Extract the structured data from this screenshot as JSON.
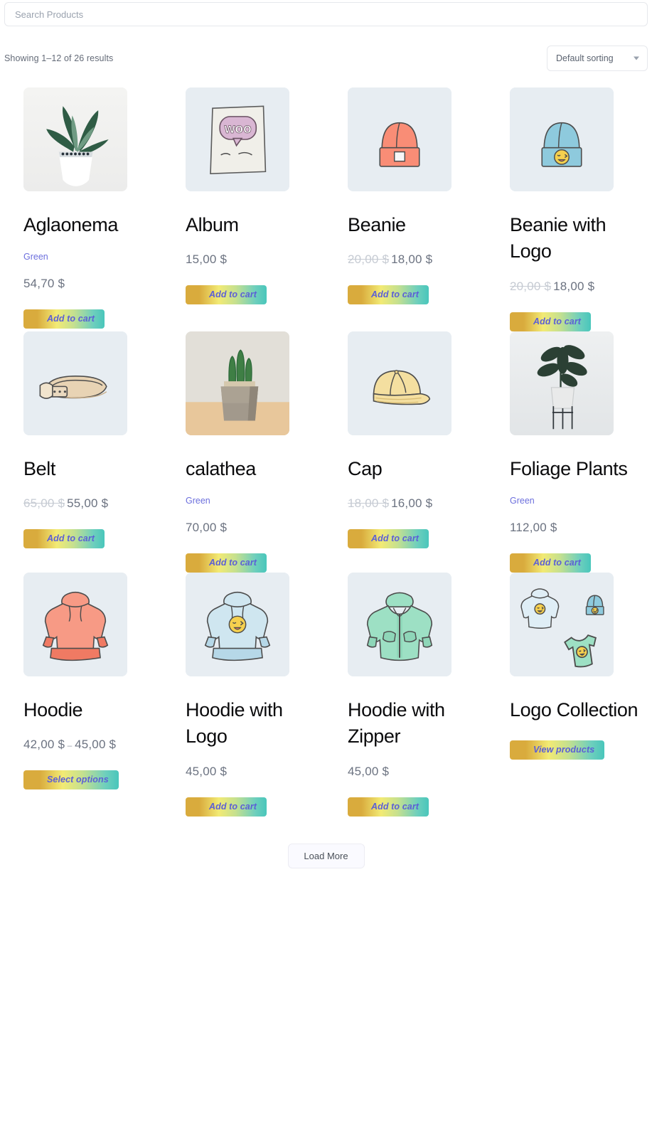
{
  "search": {
    "placeholder": "Search Products",
    "value": ""
  },
  "results": {
    "count_text": "Showing 1–12 of 26 results",
    "sorting_label": "Default sorting"
  },
  "colors": {
    "link": "#6c6fdd",
    "price": "#6b7280",
    "price_old": "#c6cbd3",
    "button_text": "#5b5fd6",
    "button_gradient_start": "#d9ab3d",
    "button_gradient_mid": "#f2ea74",
    "button_gradient_end": "#49c6bb",
    "thumb_bg": "#e7edf2"
  },
  "products": [
    {
      "name": "Aglaonema",
      "attribute": "Green",
      "price": "54,70 $",
      "old_price": "",
      "price_range_end": "",
      "button": "Add to cart",
      "image_kind": "photo-aglaonema",
      "image_alt": "potted aglaonema plant in white pot"
    },
    {
      "name": "Album",
      "attribute": "",
      "price": "15,00 $",
      "old_price": "",
      "price_range_end": "",
      "button": "Add to cart",
      "image_kind": "illus-album",
      "image_alt": "Woo the album sketch cover"
    },
    {
      "name": "Beanie",
      "attribute": "",
      "price": "18,00 $",
      "old_price": "20,00 $",
      "price_range_end": "",
      "button": "Add to cart",
      "image_kind": "illus-beanie",
      "image_alt": "salmon coloured beanie hat"
    },
    {
      "name": "Beanie with Logo",
      "attribute": "",
      "price": "18,00 $",
      "old_price": "20,00 $",
      "price_range_end": "",
      "button": "Add to cart",
      "image_kind": "illus-beanie-logo",
      "image_alt": "blue beanie hat with winking face logo"
    },
    {
      "name": "Belt",
      "attribute": "",
      "price": "55,00 $",
      "old_price": "65,00 $",
      "price_range_end": "",
      "button": "Add to cart",
      "image_kind": "illus-belt",
      "image_alt": "tan leather belt"
    },
    {
      "name": "calathea",
      "attribute": "Green",
      "price": "70,00 $",
      "old_price": "",
      "price_range_end": "",
      "button": "Add to cart",
      "image_kind": "photo-calathea",
      "image_alt": "cactus in concrete cube pot"
    },
    {
      "name": "Cap",
      "attribute": "",
      "price": "16,00 $",
      "old_price": "18,00 $",
      "price_range_end": "",
      "button": "Add to cart",
      "image_kind": "illus-cap",
      "image_alt": "yellow baseball cap"
    },
    {
      "name": "Foliage Plants",
      "attribute": "Green",
      "price": "112,00 $",
      "old_price": "",
      "price_range_end": "",
      "button": "Add to cart",
      "image_kind": "photo-foliage",
      "image_alt": "rubber plant in white pot on stand"
    },
    {
      "name": "Hoodie",
      "attribute": "",
      "price": "42,00 $",
      "old_price": "",
      "price_range_end": "45,00 $",
      "button": "Select options",
      "image_kind": "illus-hoodie",
      "image_alt": "salmon pullover hoodie"
    },
    {
      "name": "Hoodie with Logo",
      "attribute": "",
      "price": "45,00 $",
      "old_price": "",
      "price_range_end": "",
      "button": "Add to cart",
      "image_kind": "illus-hoodie-logo",
      "image_alt": "light blue hoodie with winking face logo"
    },
    {
      "name": "Hoodie with Zipper",
      "attribute": "",
      "price": "45,00 $",
      "old_price": "",
      "price_range_end": "",
      "button": "Add to cart",
      "image_kind": "illus-hoodie-zip",
      "image_alt": "mint green zip up hoodie"
    },
    {
      "name": "Logo Collection",
      "attribute": "",
      "price": "",
      "old_price": "",
      "price_range_end": "",
      "button": "View products",
      "image_kind": "illus-collection",
      "image_alt": "hoodie beanie and t-shirt with logo"
    }
  ],
  "load_more": {
    "label": "Load More"
  }
}
